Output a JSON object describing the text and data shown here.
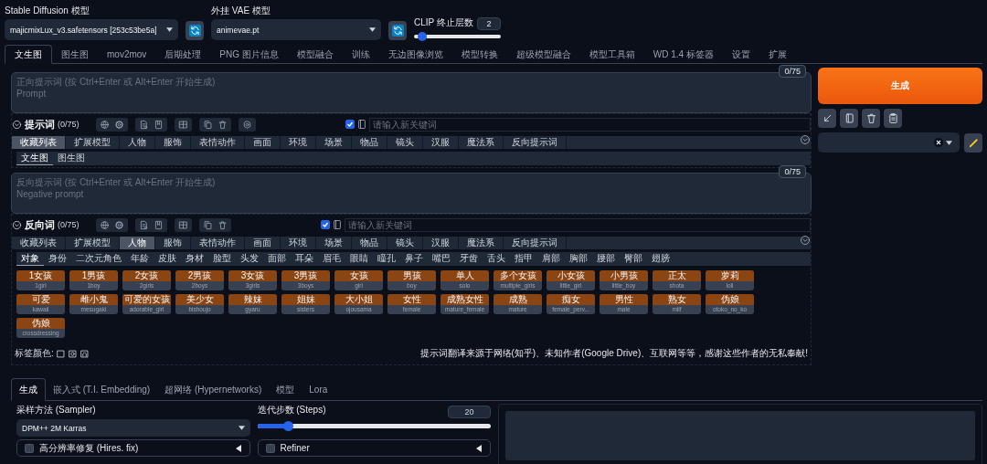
{
  "model_selectors": [
    {
      "label": "Stable Diffusion 模型",
      "value": "majicmixLux_v3.safetensors [253c53be5a]"
    },
    {
      "label": "外挂 VAE 模型",
      "value": "animevae.pt"
    }
  ],
  "clip_skip": {
    "label": "CLIP 终止层数",
    "value": "2",
    "level": 0.09
  },
  "main_tabs": [
    {
      "label": "文生图",
      "selected": true
    },
    {
      "label": "图生图",
      "selected": false
    },
    {
      "label": "mov2mov",
      "selected": false
    },
    {
      "label": "后期处理",
      "selected": false
    },
    {
      "label": "PNG 图片信息",
      "selected": false
    },
    {
      "label": "模型融合",
      "selected": false
    },
    {
      "label": "训练",
      "selected": false
    },
    {
      "label": "无边图像浏览",
      "selected": false
    },
    {
      "label": "模型转换",
      "selected": false
    },
    {
      "label": "超级模型融合",
      "selected": false
    },
    {
      "label": "模型工具箱",
      "selected": false
    },
    {
      "label": "WD 1.4 标签器",
      "selected": false
    },
    {
      "label": "设置",
      "selected": false
    },
    {
      "label": "扩展",
      "selected": false
    }
  ],
  "prompts": [
    {
      "token_count": "0/75",
      "placeholder": "正向提示词 (按 Ctrl+Enter 或 Alt+Enter 开始生成)\nPrompt",
      "helper_title": "提示词",
      "helper_count": "(0/75)",
      "keyword_checked": true,
      "keyword_placeholder": "请输入新关键词",
      "categories": [
        {
          "label": "收藏列表",
          "selected": true
        },
        {
          "label": "扩展模型",
          "selected": false
        },
        {
          "label": "人物",
          "selected": false
        },
        {
          "label": "服饰",
          "selected": false
        },
        {
          "label": "表情动作",
          "selected": false
        },
        {
          "label": "画面",
          "selected": false
        },
        {
          "label": "环境",
          "selected": false
        },
        {
          "label": "场景",
          "selected": false
        },
        {
          "label": "物品",
          "selected": false
        },
        {
          "label": "镜头",
          "selected": false
        },
        {
          "label": "汉服",
          "selected": false
        },
        {
          "label": "魔法系",
          "selected": false
        },
        {
          "label": "反向提示词",
          "selected": false
        }
      ],
      "subtabs": [
        {
          "label": "文生图",
          "selected": true
        },
        {
          "label": "图生图",
          "selected": false
        }
      ]
    },
    {
      "token_count": "0/75",
      "placeholder": "反向提示词 (按 Ctrl+Enter 或 Alt+Enter 开始生成)\nNegative prompt",
      "helper_title": "反向词",
      "helper_count": "(0/75)",
      "keyword_checked": true,
      "keyword_placeholder": "请输入新关键词",
      "categories": [
        {
          "label": "收藏列表",
          "selected": false
        },
        {
          "label": "扩展模型",
          "selected": false
        },
        {
          "label": "人物",
          "selected": true
        },
        {
          "label": "服饰",
          "selected": false
        },
        {
          "label": "表情动作",
          "selected": false
        },
        {
          "label": "画面",
          "selected": false
        },
        {
          "label": "环境",
          "selected": false
        },
        {
          "label": "场景",
          "selected": false
        },
        {
          "label": "物品",
          "selected": false
        },
        {
          "label": "镜头",
          "selected": false
        },
        {
          "label": "汉服",
          "selected": false
        },
        {
          "label": "魔法系",
          "selected": false
        },
        {
          "label": "反向提示词",
          "selected": false
        }
      ],
      "subtabs": [
        {
          "label": "对象",
          "selected": true
        },
        {
          "label": "身份",
          "selected": false
        },
        {
          "label": "二次元角色",
          "selected": false
        },
        {
          "label": "年龄",
          "selected": false
        },
        {
          "label": "皮肤",
          "selected": false
        },
        {
          "label": "身材",
          "selected": false
        },
        {
          "label": "脸型",
          "selected": false
        },
        {
          "label": "头发",
          "selected": false
        },
        {
          "label": "面部",
          "selected": false
        },
        {
          "label": "耳朵",
          "selected": false
        },
        {
          "label": "眉毛",
          "selected": false
        },
        {
          "label": "眼睛",
          "selected": false
        },
        {
          "label": "瞳孔",
          "selected": false
        },
        {
          "label": "鼻子",
          "selected": false
        },
        {
          "label": "嘴巴",
          "selected": false
        },
        {
          "label": "牙齿",
          "selected": false
        },
        {
          "label": "舌头",
          "selected": false
        },
        {
          "label": "指甲",
          "selected": false
        },
        {
          "label": "肩部",
          "selected": false
        },
        {
          "label": "胸部",
          "selected": false
        },
        {
          "label": "腰部",
          "selected": false
        },
        {
          "label": "臀部",
          "selected": false
        },
        {
          "label": "翅膀",
          "selected": false
        }
      ],
      "tags": [
        {
          "zh": "1女孩",
          "en": "1girl"
        },
        {
          "zh": "1男孩",
          "en": "1boy"
        },
        {
          "zh": "2女孩",
          "en": "2girls"
        },
        {
          "zh": "2男孩",
          "en": "2boys"
        },
        {
          "zh": "3女孩",
          "en": "3girls"
        },
        {
          "zh": "3男孩",
          "en": "3boys"
        },
        {
          "zh": "女孩",
          "en": "girl"
        },
        {
          "zh": "男孩",
          "en": "boy"
        },
        {
          "zh": "单人",
          "en": "solo"
        },
        {
          "zh": "多个女孩",
          "en": "multiple_girls"
        },
        {
          "zh": "小女孩",
          "en": "little_girl"
        },
        {
          "zh": "小男孩",
          "en": "little_boy"
        },
        {
          "zh": "正太",
          "en": "shota"
        },
        {
          "zh": "萝莉",
          "en": "loli"
        },
        {
          "zh": "可爱",
          "en": "kawaii"
        },
        {
          "zh": "雌小鬼",
          "en": "mesugaki"
        },
        {
          "zh": "可爱的女孩",
          "en": "adorable_girl"
        },
        {
          "zh": "美少女",
          "en": "bishoujo"
        },
        {
          "zh": "辣妹",
          "en": "gyaru"
        },
        {
          "zh": "姐妹",
          "en": "sisters"
        },
        {
          "zh": "大小姐",
          "en": "ojousama"
        },
        {
          "zh": "女性",
          "en": "female"
        },
        {
          "zh": "成熟女性",
          "en": "mature_female"
        },
        {
          "zh": "成熟",
          "en": "mature"
        },
        {
          "zh": "痴女",
          "en": "female_perv..."
        },
        {
          "zh": "男性",
          "en": "male"
        },
        {
          "zh": "熟女",
          "en": "milf"
        },
        {
          "zh": "伪娘",
          "en": "otoko_no_ko"
        },
        {
          "zh": "伪娘",
          "en": "crossdressing"
        }
      ],
      "tag_color_label": "标签颜色:",
      "notice": "提示词翻译来源于网络(知乎)、未知作者(Google Drive)、互联网等等，感谢这些作者的无私奉献!"
    }
  ],
  "generate_button": "生成",
  "bottom_tabs": [
    {
      "label": "生成",
      "selected": true
    },
    {
      "label": "嵌入式 (T.I. Embedding)",
      "selected": false
    },
    {
      "label": "超网络 (Hypernetworks)",
      "selected": false
    },
    {
      "label": "模型",
      "selected": false
    },
    {
      "label": "Lora",
      "selected": false
    }
  ],
  "sampler": {
    "label": "采样方法 (Sampler)",
    "value": "DPM++ 2M Karras"
  },
  "steps": {
    "label": "迭代步数 (Steps)",
    "value": "20",
    "level": 0.13
  },
  "accordions": [
    {
      "label": "高分辨率修复 (Hires. fix)",
      "checked": false
    },
    {
      "label": "Refiner",
      "checked": false
    }
  ]
}
